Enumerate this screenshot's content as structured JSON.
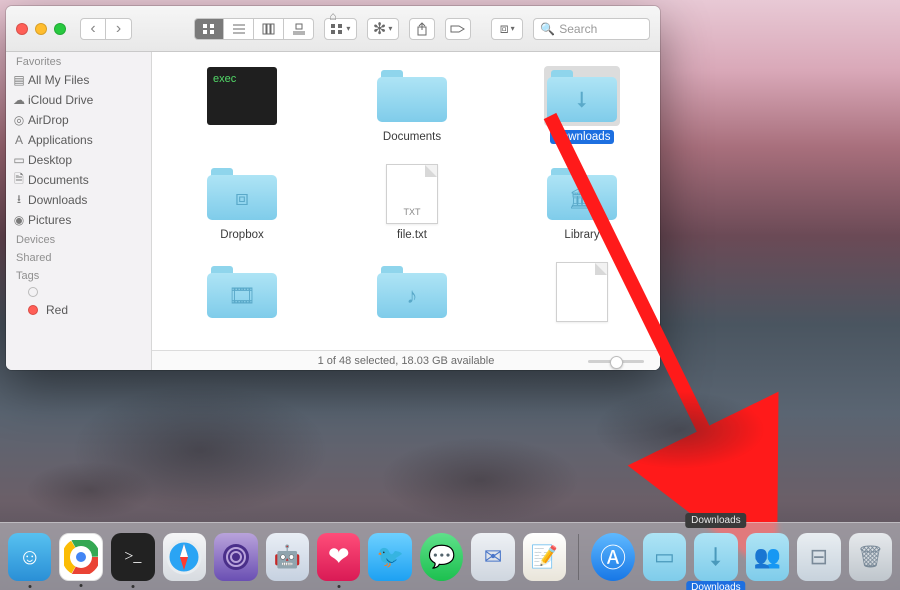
{
  "window": {
    "title_icon": "home-icon",
    "search_placeholder": "Search"
  },
  "toolbar": {
    "dropbox_label": "Dropbox"
  },
  "sidebar": {
    "sections": [
      {
        "title": "Favorites",
        "items": [
          {
            "icon": "all-my-files",
            "label": "All My Files"
          },
          {
            "icon": "cloud",
            "label": "iCloud Drive"
          },
          {
            "icon": "airdrop",
            "label": "AirDrop"
          },
          {
            "icon": "apps",
            "label": "Applications"
          },
          {
            "icon": "desktop",
            "label": "Desktop"
          },
          {
            "icon": "documents",
            "label": "Documents"
          },
          {
            "icon": "downloads",
            "label": "Downloads"
          },
          {
            "icon": "pictures",
            "label": "Pictures"
          }
        ]
      },
      {
        "title": "Devices",
        "items": []
      },
      {
        "title": "Shared",
        "items": []
      },
      {
        "title": "Tags",
        "items": [
          {
            "icon": "tag-none",
            "label": ""
          },
          {
            "icon": "tag-red",
            "label": "Red"
          }
        ]
      }
    ]
  },
  "files": {
    "row1": [
      {
        "kind": "exec",
        "name": "",
        "glyph": "exec"
      },
      {
        "kind": "folder",
        "name": "Documents",
        "glyph": ""
      },
      {
        "kind": "folder",
        "name": "Downloads",
        "glyph": "down",
        "selected": true
      }
    ],
    "row2": [
      {
        "kind": "folder",
        "name": "Dropbox",
        "glyph": "dropbox"
      },
      {
        "kind": "doc",
        "name": "file.txt",
        "glyph": "TXT"
      },
      {
        "kind": "folder",
        "name": "Library",
        "glyph": "library"
      }
    ],
    "row3": [
      {
        "kind": "folder",
        "name": "",
        "glyph": "movies"
      },
      {
        "kind": "folder",
        "name": "",
        "glyph": "music"
      },
      {
        "kind": "doc",
        "name": "",
        "glyph": ""
      }
    ]
  },
  "status": {
    "text": "1 of 48 selected, 18.03 GB available"
  },
  "dock": {
    "tooltip": "Downloads",
    "downloads_label": "Downloads",
    "items": [
      {
        "name": "finder",
        "running": true
      },
      {
        "name": "chrome",
        "running": true
      },
      {
        "name": "terminal",
        "running": true
      },
      {
        "name": "safari",
        "running": false
      },
      {
        "name": "tor",
        "running": false
      },
      {
        "name": "automator",
        "running": false
      },
      {
        "name": "skitch",
        "running": true
      },
      {
        "name": "twitter",
        "running": false
      },
      {
        "name": "messages",
        "running": false
      },
      {
        "name": "mail",
        "running": false
      },
      {
        "name": "notes",
        "running": false
      }
    ]
  }
}
